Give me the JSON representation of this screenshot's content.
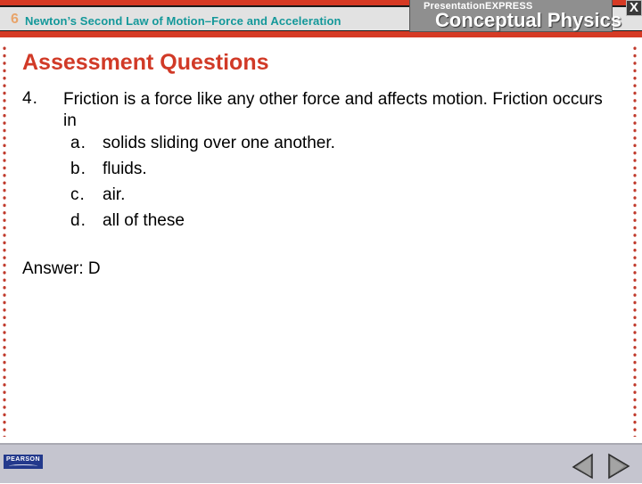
{
  "header": {
    "chapter_number": "6",
    "chapter_title": "Newton’s Second Law of Motion–Force and Acceleration",
    "brand_presentation": "Presentation",
    "brand_express": "EXPRESS",
    "brand_product": "Conceptual Physics",
    "close_label": "X"
  },
  "slide": {
    "title": "Assessment Questions",
    "question": {
      "number": "4.",
      "text": "Friction is a force like any other force and affects motion. Friction occurs in",
      "choices": [
        {
          "letter": "a.",
          "text": "solids sliding over one another."
        },
        {
          "letter": "b.",
          "text": "fluids."
        },
        {
          "letter": "c.",
          "text": "air."
        },
        {
          "letter": "d.",
          "text": "all of these"
        }
      ]
    },
    "answer": "Answer: D"
  },
  "footer": {
    "logo_text": "PEARSON",
    "prev_icon": "previous-arrow-icon",
    "next_icon": "next-arrow-icon"
  },
  "colors": {
    "accent_red": "#d63a24",
    "title_red": "#d13a27",
    "chapter_teal": "#14989a",
    "chapter_number_orange": "#e8a46a",
    "footer_grey": "#c5c5cf",
    "pearson_blue": "#23398c"
  }
}
